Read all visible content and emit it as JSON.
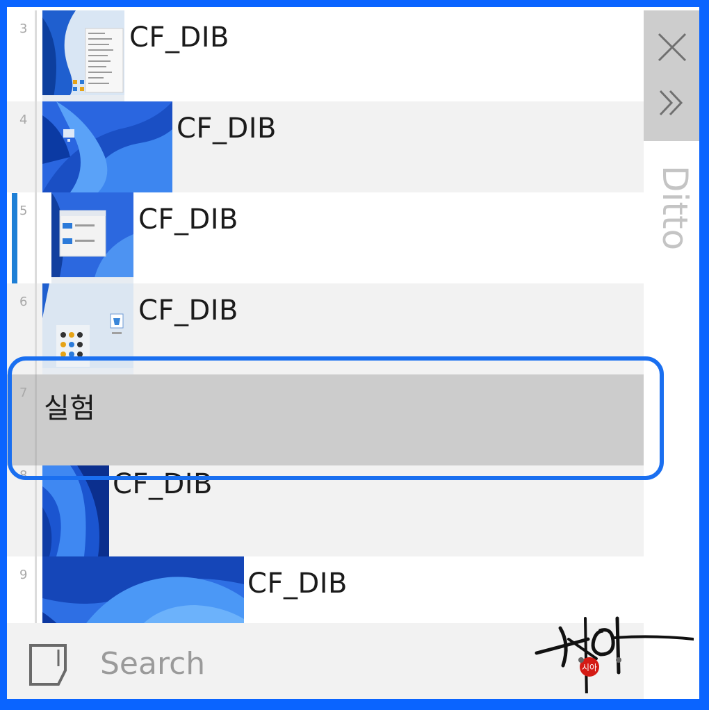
{
  "window": {
    "app_name": "Ditto",
    "accent_color": "#0a64ff"
  },
  "clips": [
    {
      "number": "3",
      "label": "CF_DIB",
      "thumbnail": "desktop-with-context-menu"
    },
    {
      "number": "4",
      "label": "CF_DIB",
      "thumbnail": "windows-11-wallpaper"
    },
    {
      "number": "5",
      "label": "CF_DIB",
      "thumbnail": "file-explorer-window",
      "active": true
    },
    {
      "number": "6",
      "label": "CF_DIB",
      "thumbnail": "desktop-recycle-bin"
    },
    {
      "number": "7",
      "label": "실험",
      "selected": true
    },
    {
      "number": "8",
      "label": "CF_DIB",
      "thumbnail": "windows-11-wallpaper"
    },
    {
      "number": "9",
      "label": "CF_DIB",
      "thumbnail": "windows-11-bloom"
    }
  ],
  "sidebar": {
    "close_icon": "close-icon",
    "expand_icon": "double-chevron-right-icon",
    "vertical_title": "Ditto"
  },
  "search": {
    "placeholder": "Search",
    "icon": "clipboard-icon"
  },
  "annotation": {
    "highlight_color": "#1a6ff0",
    "logo_text": "시아"
  }
}
